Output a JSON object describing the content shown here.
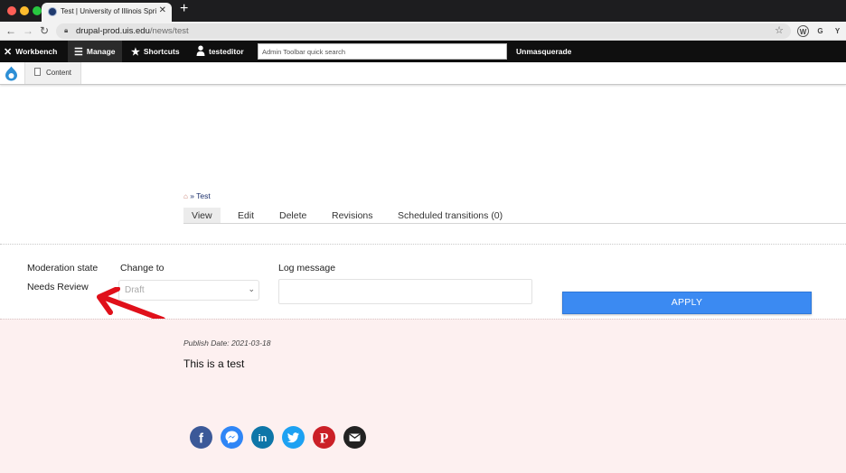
{
  "browser": {
    "tab_title": "Test | University of Illinois Spri",
    "new_tab_label": "+",
    "url_domain": "drupal-prod.uis.edu",
    "url_path": "/news/test",
    "extensions": [
      "W",
      "G",
      "Y"
    ]
  },
  "toolbar": {
    "workbench": "Workbench",
    "manage": "Manage",
    "shortcuts": "Shortcuts",
    "user": "testeditor",
    "search_placeholder": "Admin Toolbar quick search",
    "unmasquerade": "Unmasquerade",
    "content": "Content"
  },
  "breadcrumb": {
    "home_icon": "home-icon",
    "separator": "»",
    "current": "Test"
  },
  "tabs": [
    "View",
    "Edit",
    "Delete",
    "Revisions",
    "Scheduled transitions (0)"
  ],
  "active_tab": "View",
  "moderation": {
    "state_label": "Moderation state",
    "state_value": "Needs Review",
    "change_to_label": "Change to",
    "change_to_value": "Draft",
    "log_label": "Log message",
    "log_value": "",
    "apply_label": "APPLY"
  },
  "content": {
    "publish_label": "Publish Date:",
    "publish_date": "2021-03-18",
    "body": "This is a test"
  },
  "share_icons": [
    {
      "name": "facebook-icon",
      "color": "#3b5998"
    },
    {
      "name": "messenger-icon",
      "color": "#2f86f6"
    },
    {
      "name": "linkedin-icon",
      "color": "#0e76a8"
    },
    {
      "name": "twitter-icon",
      "color": "#1da1f2"
    },
    {
      "name": "pinterest-icon",
      "color": "#cb2027"
    },
    {
      "name": "email-icon",
      "color": "#222222"
    }
  ],
  "colors": {
    "apply_button": "#3b8af2",
    "preview_background": "#fdf0f0",
    "annotation_arrow": "#e0101a"
  }
}
